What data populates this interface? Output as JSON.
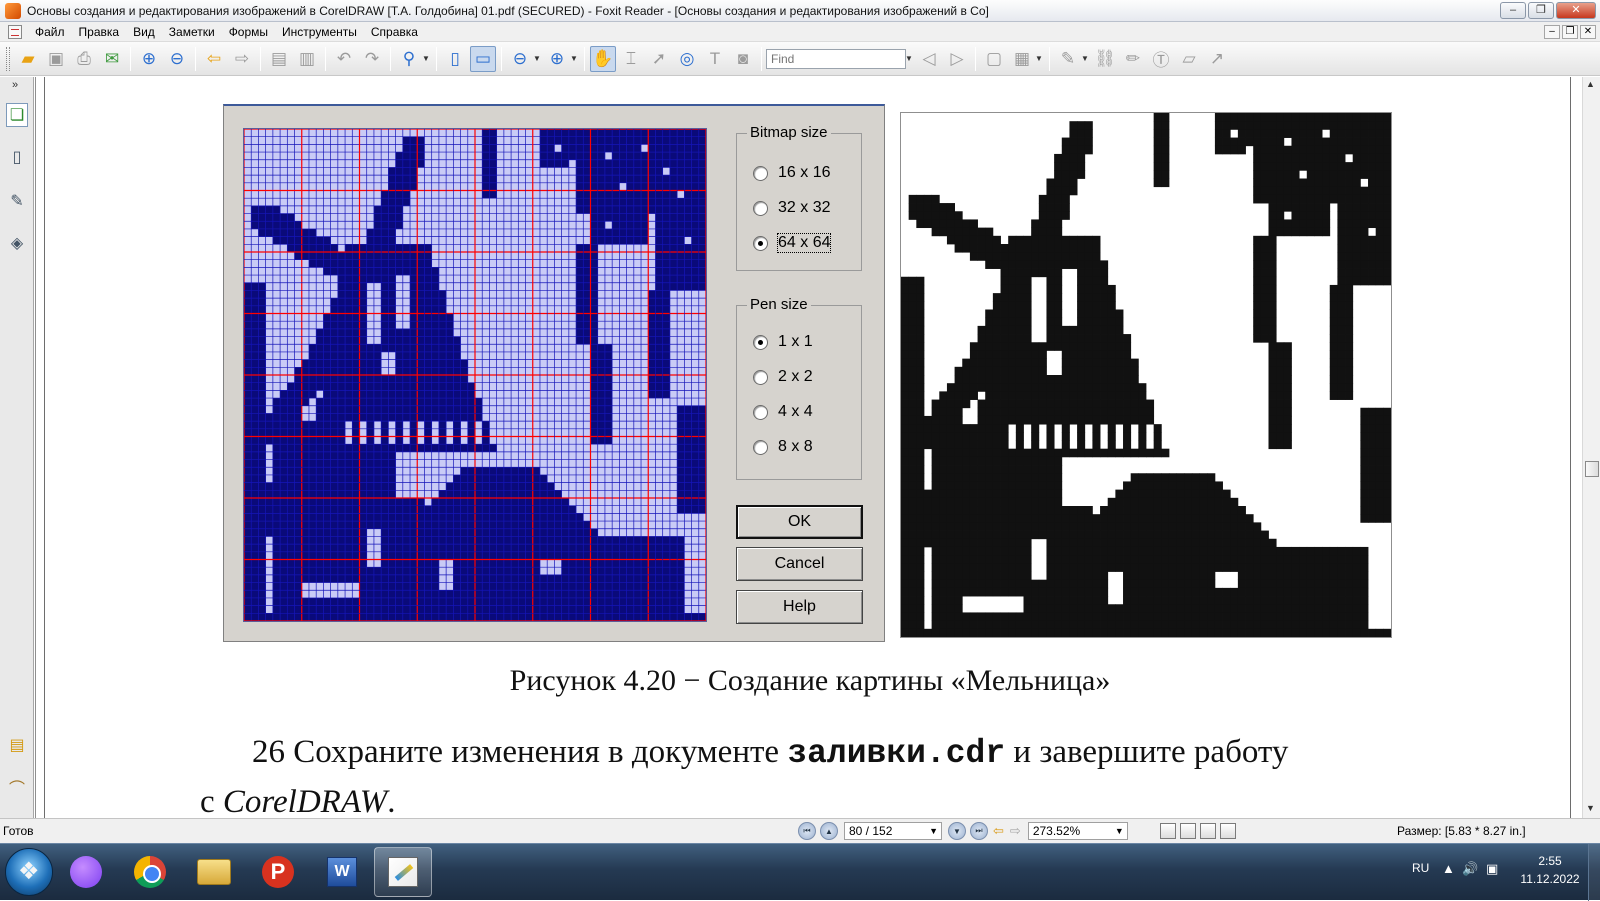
{
  "window": {
    "title": "Основы создания и редактирования изображений в CorelDRAW [Т.А. Голдобина] 01.pdf (SECURED) - Foxit Reader - [Основы создания и редактирования изображений в Со]",
    "btn_minimize": "–",
    "btn_restore": "❐",
    "btn_close": "✕"
  },
  "menu": {
    "items": [
      "Файл",
      "Правка",
      "Вид",
      "Заметки",
      "Формы",
      "Инструменты",
      "Справка"
    ],
    "doc_minimize": "–",
    "doc_restore": "❐",
    "doc_close": "✕"
  },
  "toolbar": {
    "find_placeholder": "Find"
  },
  "left_panel": {
    "collapse_glyph": "»"
  },
  "figure": {
    "bitmap_size_title": "Bitmap size",
    "bitmap_options": [
      "16 x 16",
      "32 x 32",
      "64 x 64"
    ],
    "bitmap_selected": "64 x 64",
    "pen_size_title": "Pen size",
    "pen_options": [
      "1 x 1",
      "2 x 2",
      "4 x 4",
      "8 x 8"
    ],
    "pen_selected": "1 x 1",
    "ok_label": "OK",
    "cancel_label": "Cancel",
    "help_label": "Help",
    "grid_cells": 64,
    "colors": {
      "dialog_bg": "#d6d3ce",
      "pixel_on": "#0a0a7a",
      "pixel_off": "#c9cbf6",
      "cell_line": "#1515b8",
      "major_line": "#ff0000",
      "preview_on": "#111111",
      "preview_off": "#ffffff"
    }
  },
  "document": {
    "caption": "Рисунок 4.20 − Создание картины «Мельница»",
    "para_number": "26",
    "para_text_1": "Сохраните изменения в документе",
    "para_filename": "заливки.cdr",
    "para_text_2": "и завершите работу",
    "para_text_3": "с",
    "para_app": "CorelDRAW",
    "para_end": "."
  },
  "status": {
    "ready": "Готов",
    "page": "80 / 152",
    "zoom": "273.52%",
    "size": "Размер: [5.83 * 8.27 in.]"
  },
  "taskbar": {
    "lang": "RU",
    "time": "2:55",
    "date": "11.12.2022"
  }
}
